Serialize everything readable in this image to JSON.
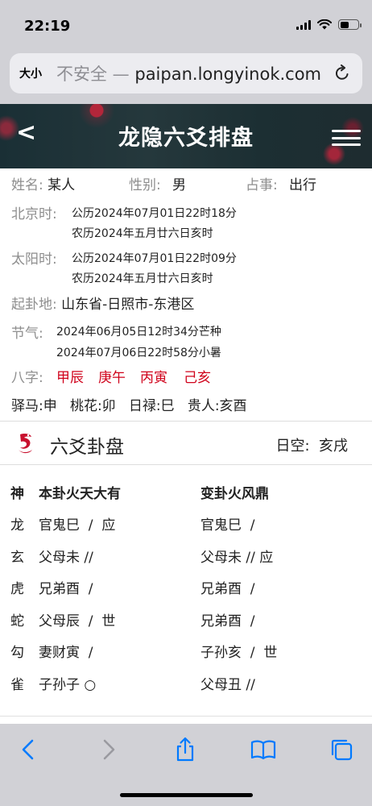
{
  "status": {
    "time": "22:19"
  },
  "browser": {
    "text_size": "大小",
    "insecure": "不安全 — ",
    "domain": "paipan.longyinok.com"
  },
  "header": {
    "back": "<",
    "title": "龙隐六爻排盘"
  },
  "info": {
    "name_label": "姓名:",
    "name": "某人",
    "gender_label": "性别:",
    "gender": "男",
    "matter_label": "占事:",
    "matter": "出行",
    "beijing_label": "北京时:",
    "beijing_solar": "公历2024年07月01日22时18分",
    "beijing_lunar": "农历2024年五月廿六日亥时",
    "sun_label": "太阳时:",
    "sun_solar": "公历2024年07月01日22时09分",
    "sun_lunar": "农历2024年五月廿六日亥时",
    "place_label": "起卦地:",
    "place": "山东省-日照市-东港区",
    "term_label": "节气:",
    "term1": "2024年06月05日12时34分芒种",
    "term2": "2024年07月06日22时58分小暑",
    "bazi_label": "八字:",
    "bazi": [
      "甲辰",
      "庚午",
      "丙寅",
      "己亥"
    ],
    "shensha": "驿马:申   桃花:卯   日禄:巳   贵人:亥酉"
  },
  "hexagram": {
    "title": "六爻卦盘",
    "rikong": "日空:  亥戌",
    "head": {
      "shen": "神",
      "ben": "本卦火天大有",
      "bian": "变卦火风鼎"
    },
    "rows": [
      {
        "shen": "龙",
        "ben": "官鬼巳  /  应",
        "bian": "官鬼巳  /"
      },
      {
        "shen": "玄",
        "ben": "父母未 //",
        "bian": "父母未 // 应"
      },
      {
        "shen": "虎",
        "ben": "兄弟酉  /",
        "bian": "兄弟酉  /"
      },
      {
        "shen": "蛇",
        "ben": "父母辰  /  世",
        "bian": "兄弟酉  /"
      },
      {
        "shen": "勾",
        "ben": "妻财寅  /",
        "bian": "子孙亥  /  世"
      },
      {
        "shen": "雀",
        "ben": "子孙子 ○",
        "bian": "父母丑 //"
      }
    ]
  },
  "colors": {
    "accent_red": "#d0021b",
    "ios_blue": "#007aff",
    "header_bg": "#1f3236"
  }
}
